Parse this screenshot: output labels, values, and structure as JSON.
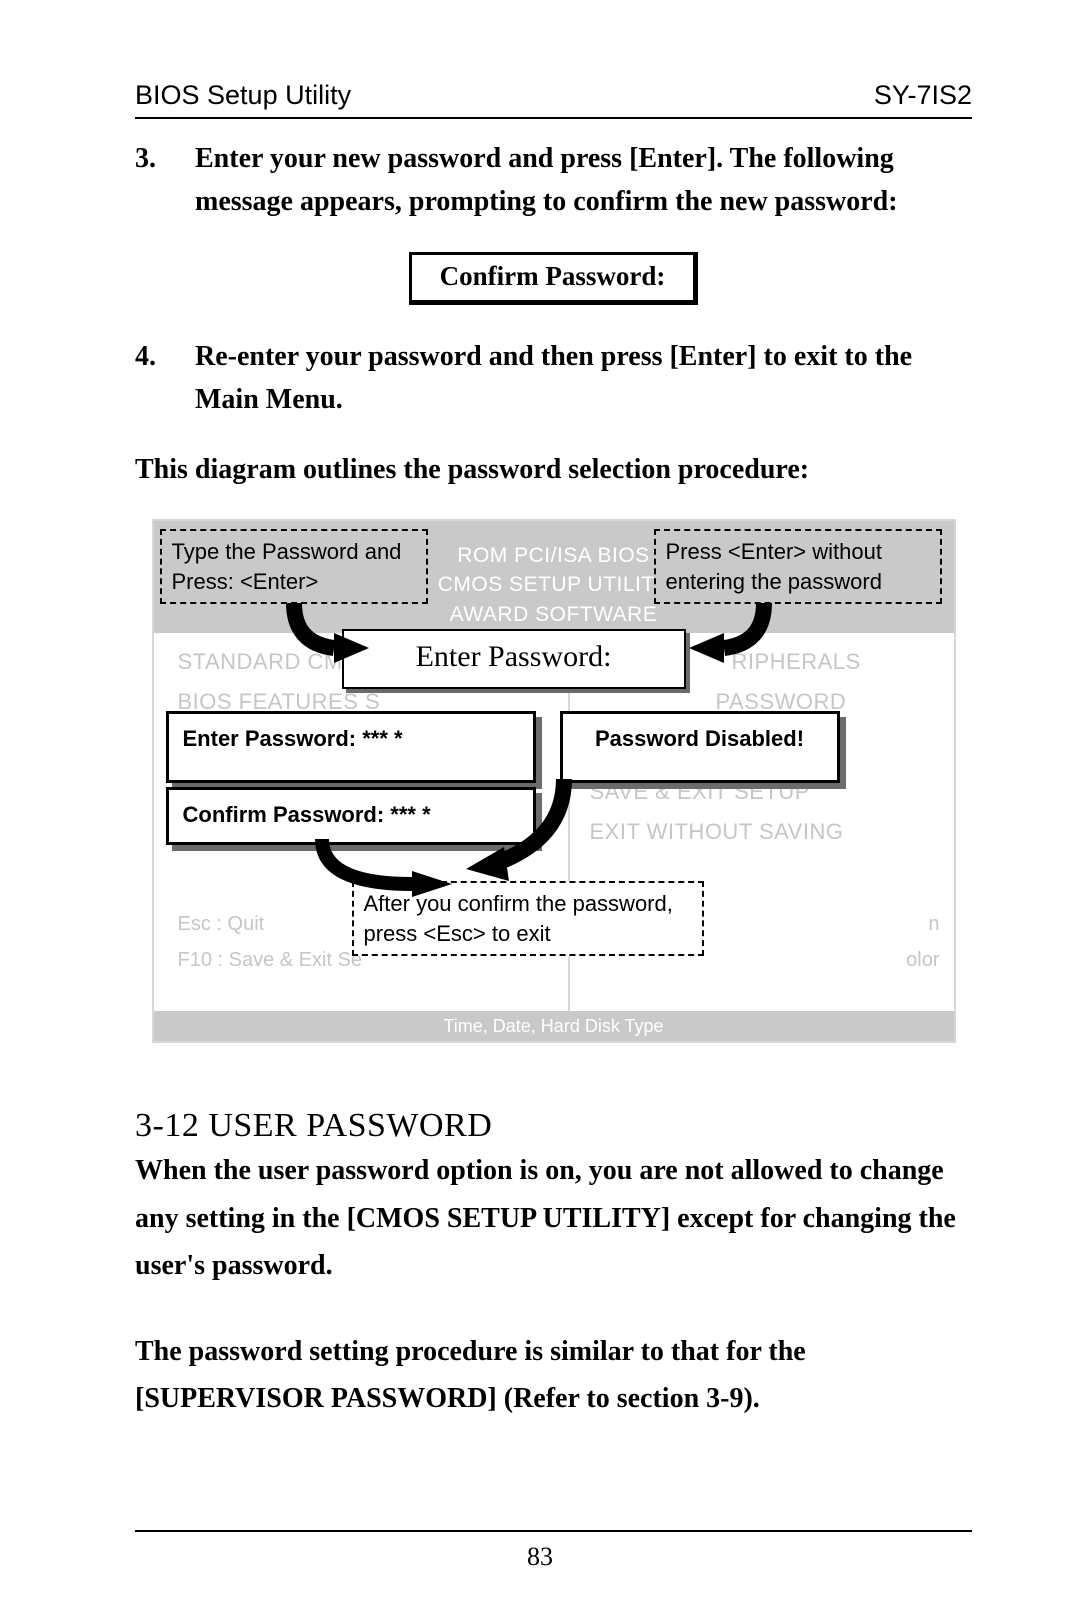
{
  "header": {
    "left": "BIOS Setup Utility",
    "right": "SY-7IS2"
  },
  "step3": {
    "num": "3.",
    "text": "Enter your new password and press [Enter]. The following message appears, prompting to confirm the new password:"
  },
  "confirm_box": "Confirm Password:",
  "step4": {
    "num": "4.",
    "text": "Re-enter your password and then press [Enter] to exit to the Main Menu."
  },
  "outline_para": "This diagram outlines the password selection procedure:",
  "diagram": {
    "head1": "ROM PCI/ISA BIOS",
    "head2": "CMOS SETUP UTILITY",
    "head3": "AWARD SOFTWARE",
    "menu_left": [
      "STANDARD CMOS",
      "BIOS FEATURES S"
    ],
    "menu_right": [
      "RIPHERALS",
      "PASSWORD",
      "SAVE & EXIT SETUP",
      "EXIT WITHOUT SAVING"
    ],
    "help1": "Esc   : Quit",
    "help2": "F10  : Save & Exit Se",
    "help_right_suffix1": "n",
    "help_right_suffix2": "olor",
    "footer": "Time, Date, Hard Disk Type",
    "callout_type": "Type the Password and Press: <Enter>",
    "callout_noentry": "Press <Enter> without entering the password",
    "callout_after": "After you confirm the password, press <Esc> to exit",
    "center_title": "Enter Password:",
    "box_enter": "Enter Password: ***  *",
    "box_confirm": "Confirm Password: ***  *",
    "box_disabled": "Password Disabled!"
  },
  "section": {
    "title": "3-12   USER PASSWORD",
    "p1": "When the user password option is on, you are not allowed to change any setting in the [CMOS SETUP UTILITY] except for changing the user's password.",
    "p2": "The password setting procedure is similar to that for the [SUPERVISOR PASSWORD] (Refer to section 3-9)."
  },
  "page_number": "83"
}
